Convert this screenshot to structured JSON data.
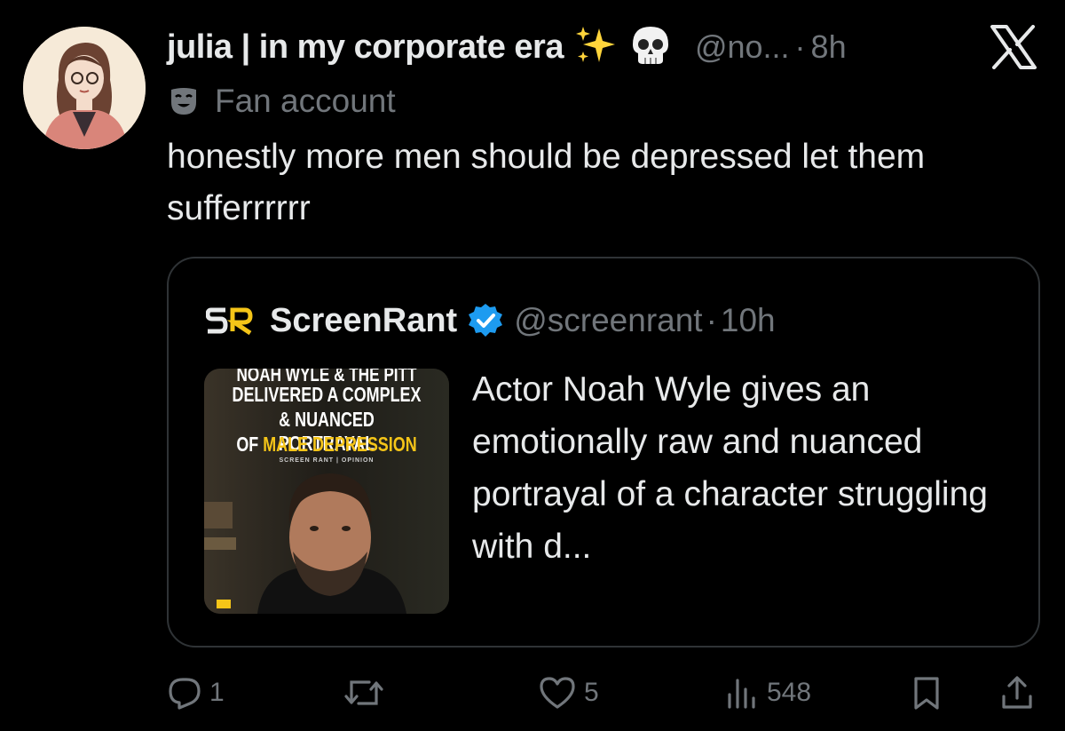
{
  "author": {
    "name": "julia | in my corporate era",
    "handle": "@no...",
    "time": "8h",
    "label": "Fan account"
  },
  "tweet": {
    "text": "honestly more men should be depressed let them sufferrrrrr"
  },
  "quote": {
    "name": "ScreenRant",
    "handle": "@screenrant",
    "time": "10h",
    "text": "Actor Noah Wyle gives an emotionally raw and nuanced portrayal of a character struggling with d...",
    "thumbnail": {
      "line_cut": "NOAH WYLE & THE PITT",
      "line1": "DELIVERED A COMPLEX",
      "line2": "& NUANCED PORTRAYAL",
      "line3_prefix": "OF ",
      "line3_highlight": "MALE DEPRESSION",
      "byline": "SCREEN RANT | OPINION"
    }
  },
  "actions": {
    "replies": "1",
    "likes": "5",
    "views": "548"
  },
  "separators": {
    "dot": "·"
  },
  "icons": [
    "x-logo-icon",
    "sparkles-icon",
    "skull-icon",
    "mask-icon",
    "verified-badge-icon",
    "reply-icon",
    "repost-icon",
    "like-icon",
    "views-icon",
    "bookmark-icon",
    "share-icon"
  ],
  "colors": {
    "background": "#000000",
    "text": "#e7e9ea",
    "muted": "#71767b",
    "verified": "#1d9bf0",
    "accent_yellow": "#f5c518"
  }
}
